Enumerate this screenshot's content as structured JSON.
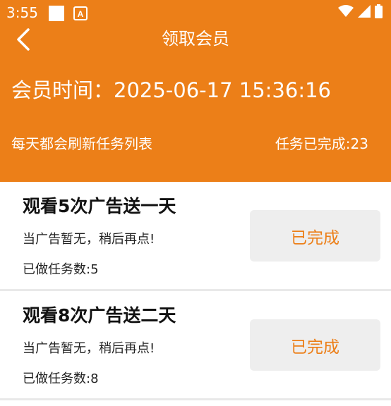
{
  "status_bar": {
    "time": "3:55",
    "icons": [
      "notification-square-icon",
      "keyboard-a-icon",
      "wifi-icon",
      "signal-icon",
      "battery-icon"
    ]
  },
  "header": {
    "back_icon": "chevron-left-icon",
    "title": "领取会员",
    "member_time": "会员时间：2025-06-17 15:36:16",
    "refresh_note": "每天都会刷新任务列表",
    "tasks_done": "任务已完成:23"
  },
  "tasks": [
    {
      "title": "观看5次广告送一天",
      "note": "当广告暂无，稍后再点!",
      "count": "已做任务数:5",
      "button": "已完成"
    },
    {
      "title": "观看8次广告送二天",
      "note": "当广告暂无，稍后再点!",
      "count": "已做任务数:8",
      "button": "已完成"
    }
  ],
  "colors": {
    "brand": "#ec7f18",
    "button_bg": "#eeeeee",
    "divider": "#e9e9e9"
  }
}
